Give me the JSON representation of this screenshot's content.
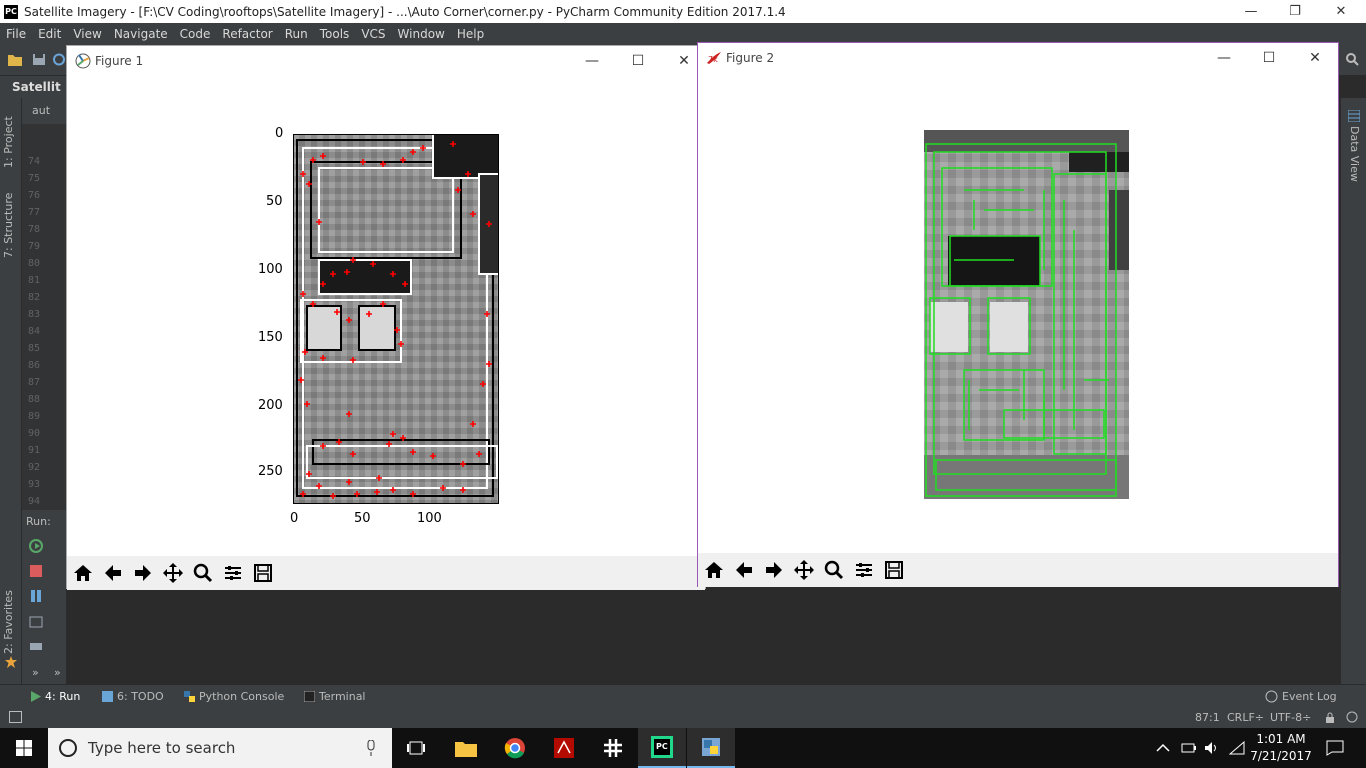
{
  "window": {
    "title": "Satellite Imagery - [F:\\CV Coding\\rooftops\\Satellite Imagery] - ...\\Auto Corner\\corner.py - PyCharm Community Edition 2017.1.4",
    "app_logo": "PC",
    "minimize": "—",
    "restore": "❐",
    "close": "✕"
  },
  "menu": [
    "File",
    "Edit",
    "View",
    "Navigate",
    "Code",
    "Refactor",
    "Run",
    "Tools",
    "VCS",
    "Window",
    "Help"
  ],
  "navbar": {
    "project": "Satellit"
  },
  "project_tree": {
    "node": "aut"
  },
  "left_tabs": {
    "project": "1: Project",
    "structure": "7: Structure",
    "favorites": "2: Favorites"
  },
  "right_tabs": {
    "data_view": "Data View"
  },
  "gutter_lines": [
    "74",
    "75",
    "76",
    "77",
    "78",
    "79",
    "80",
    "81",
    "82",
    "83",
    "84",
    "85",
    "86",
    "87",
    "88",
    "89",
    "90",
    "91",
    "92",
    "93",
    "94"
  ],
  "run_panel": {
    "label": "Run:",
    "more1": "»",
    "more2": "»"
  },
  "bottom_tabs": [
    {
      "label": "4: Run",
      "icon": "run-icon"
    },
    {
      "label": "6: TODO",
      "icon": "todo-icon"
    },
    {
      "label": "Python Console",
      "icon": "python-console-icon"
    },
    {
      "label": "Terminal",
      "icon": "terminal-icon"
    }
  ],
  "event_log": "Event Log",
  "status": {
    "position": "87:1",
    "line_sep": "CRLF÷",
    "encoding": "UTF-8÷"
  },
  "figure1": {
    "title": "Figure 1",
    "chart_data": {
      "type": "heatmap",
      "title": "",
      "xlabel": "",
      "ylabel": "",
      "xticks": [
        "0",
        "50",
        "100"
      ],
      "yticks": [
        "0",
        "50",
        "100",
        "150",
        "200",
        "250"
      ],
      "xlim": [
        0,
        150
      ],
      "ylim": [
        272,
        0
      ],
      "colormap": "gray",
      "marker_color": "#ff0000",
      "marker": "+"
    }
  },
  "figure2": {
    "title": "Figure 2",
    "image": "grayscale satellite rooftop with green contour overlay",
    "overlay_color": "#22dd22"
  },
  "fig_toolbar": [
    "home-icon",
    "back-icon",
    "forward-icon",
    "pan-icon",
    "zoom-icon",
    "configure-icon",
    "save-icon"
  ],
  "taskbar": {
    "search_placeholder": "Type here to search",
    "time": "1:01 AM",
    "date": "7/21/2017",
    "apps": [
      "task-view-icon",
      "file-explorer-icon",
      "chrome-icon",
      "acrobat-icon",
      "slack-icon",
      "pycharm-icon",
      "python-icon"
    ]
  }
}
